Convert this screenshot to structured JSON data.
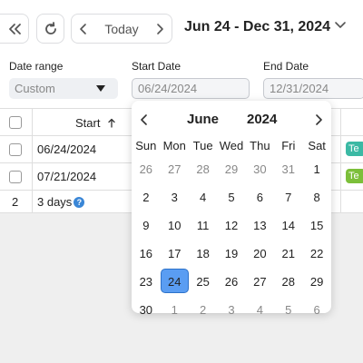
{
  "toolbar": {
    "today_label": "Today",
    "date_range_title": "Jun 24 - Dec 31, 2024"
  },
  "filters": {
    "date_range_label": "Date range",
    "date_range_value": "Custom",
    "start_date_label": "Start Date",
    "start_date_value": "06/24/2024",
    "end_date_label": "End Date",
    "end_date_value": "12/31/2024"
  },
  "table": {
    "start_header": "Start",
    "rows": [
      {
        "start": "06/24/2024",
        "tag": "Te",
        "tag_color": "#3bb9a4"
      },
      {
        "start": "07/21/2024",
        "tag": "Te",
        "tag_color": "#7cbf3a"
      }
    ],
    "summary": {
      "count": "2",
      "duration": "3 days"
    }
  },
  "calendar": {
    "month": "June",
    "year": "2024",
    "weekdays": [
      "Sun",
      "Mon",
      "Tue",
      "Wed",
      "Thu",
      "Fri",
      "Sat"
    ],
    "days": [
      {
        "d": "26",
        "other": true
      },
      {
        "d": "27",
        "other": true
      },
      {
        "d": "28",
        "other": true
      },
      {
        "d": "29",
        "other": true
      },
      {
        "d": "30",
        "other": true
      },
      {
        "d": "31",
        "other": true
      },
      {
        "d": "1"
      },
      {
        "d": "2"
      },
      {
        "d": "3"
      },
      {
        "d": "4"
      },
      {
        "d": "5"
      },
      {
        "d": "6"
      },
      {
        "d": "7"
      },
      {
        "d": "8"
      },
      {
        "d": "9"
      },
      {
        "d": "10"
      },
      {
        "d": "11"
      },
      {
        "d": "12"
      },
      {
        "d": "13"
      },
      {
        "d": "14"
      },
      {
        "d": "15"
      },
      {
        "d": "16"
      },
      {
        "d": "17"
      },
      {
        "d": "18"
      },
      {
        "d": "19"
      },
      {
        "d": "20"
      },
      {
        "d": "21"
      },
      {
        "d": "22"
      },
      {
        "d": "23"
      },
      {
        "d": "24",
        "selected": true
      },
      {
        "d": "25"
      },
      {
        "d": "26"
      },
      {
        "d": "27"
      },
      {
        "d": "28"
      },
      {
        "d": "29"
      },
      {
        "d": "30"
      },
      {
        "d": "1",
        "other": true
      },
      {
        "d": "2",
        "other": true
      },
      {
        "d": "3",
        "other": true
      },
      {
        "d": "4",
        "other": true
      },
      {
        "d": "5",
        "other": true
      },
      {
        "d": "6",
        "other": true
      }
    ],
    "selected_color": "#5a9df2"
  },
  "icons": [
    "double-chevron-left-icon",
    "refresh-icon",
    "chevron-left-icon",
    "chevron-right-icon",
    "chevron-down-icon",
    "caret-down-icon",
    "sort-arrow-up-icon",
    "help-icon"
  ]
}
